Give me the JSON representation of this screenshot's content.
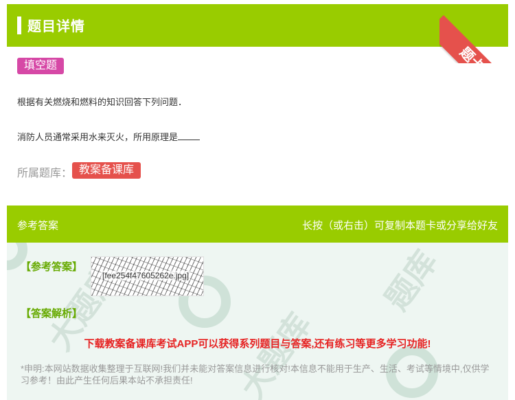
{
  "header": {
    "title": "题目详情",
    "ribbon_label": "题卡"
  },
  "question": {
    "type_tag": "填空题",
    "stem": "根据有关燃烧和燃料的知识回答下列问题．",
    "sub_question": "消防人员通常采用水来灭火，所用原理是",
    "library_label": "所属题库：",
    "library_name": "教案备课库"
  },
  "answer": {
    "section_title": "参考答案",
    "share_hint": "长按（或右击）可复制本题卡或分享给好友",
    "answer_label": "【参考答案】",
    "answer_image_name": "[fee254f47605262e.jpg]",
    "explanation_label": "【答案解析】",
    "promo_text": "下载教案备课库考试APP可以获得系列题目与答案,还有练习等更多学习功能!",
    "disclaimer": "*申明:本网站数据收集整理于互联网!我们并未能对答案信息进行核对!本信息不能用于生产、生活、考试等情境中,仅供学习参考！由此产生任何后果本站不承担责任!"
  },
  "colors": {
    "header_green": "#99cc00",
    "ribbon_red": "#e5514c",
    "type_tag_magenta": "#d648a6",
    "label_green": "#66aa00",
    "promo_red": "#e62222"
  }
}
